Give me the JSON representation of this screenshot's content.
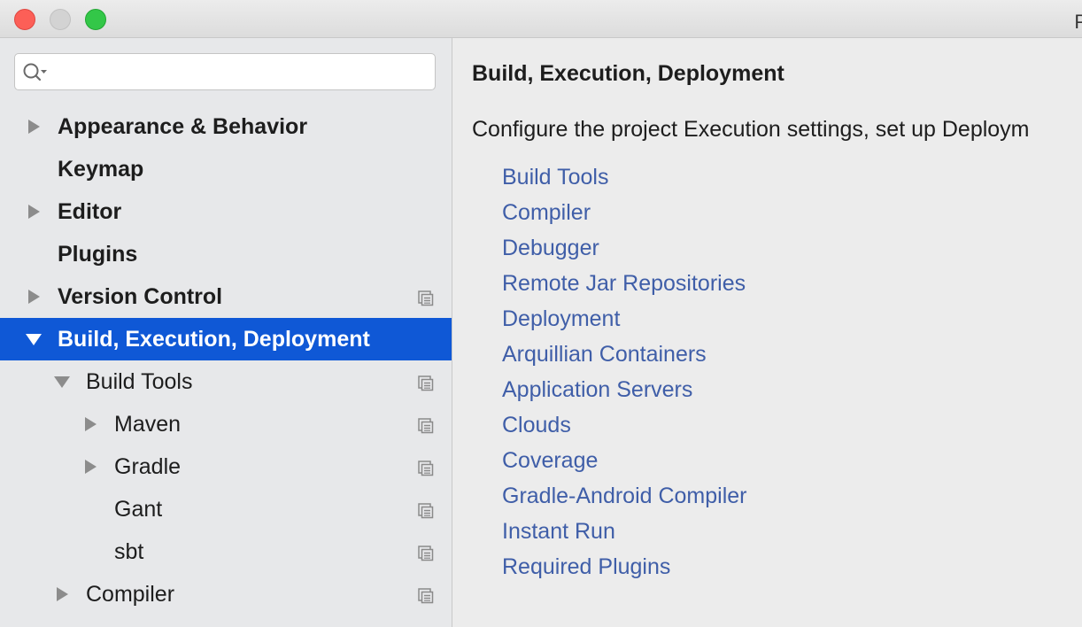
{
  "window": {
    "title": "P"
  },
  "search": {
    "placeholder": "",
    "value": ""
  },
  "tree": [
    {
      "label": "Appearance & Behavior",
      "level": 0,
      "expander": "collapsed",
      "bold": true,
      "selected": false,
      "project_icon": false
    },
    {
      "label": "Keymap",
      "level": 0,
      "expander": "none",
      "bold": true,
      "selected": false,
      "project_icon": false
    },
    {
      "label": "Editor",
      "level": 0,
      "expander": "collapsed",
      "bold": true,
      "selected": false,
      "project_icon": false
    },
    {
      "label": "Plugins",
      "level": 0,
      "expander": "none",
      "bold": true,
      "selected": false,
      "project_icon": false
    },
    {
      "label": "Version Control",
      "level": 0,
      "expander": "collapsed",
      "bold": true,
      "selected": false,
      "project_icon": true
    },
    {
      "label": "Build, Execution, Deployment",
      "level": 0,
      "expander": "expanded",
      "bold": true,
      "selected": true,
      "project_icon": false
    },
    {
      "label": "Build Tools",
      "level": 1,
      "expander": "expanded",
      "bold": false,
      "selected": false,
      "project_icon": true
    },
    {
      "label": "Maven",
      "level": 2,
      "expander": "collapsed",
      "bold": false,
      "selected": false,
      "project_icon": true
    },
    {
      "label": "Gradle",
      "level": 2,
      "expander": "collapsed",
      "bold": false,
      "selected": false,
      "project_icon": true
    },
    {
      "label": "Gant",
      "level": 2,
      "expander": "none",
      "bold": false,
      "selected": false,
      "project_icon": true
    },
    {
      "label": "sbt",
      "level": 2,
      "expander": "none",
      "bold": false,
      "selected": false,
      "project_icon": true
    },
    {
      "label": "Compiler",
      "level": 1,
      "expander": "collapsed",
      "bold": false,
      "selected": false,
      "project_icon": true
    }
  ],
  "content": {
    "title": "Build, Execution, Deployment",
    "description": "Configure the project Execution settings, set up Deploym",
    "links": [
      "Build Tools",
      "Compiler",
      "Debugger",
      "Remote Jar Repositories",
      "Deployment",
      "Arquillian Containers",
      "Application Servers",
      "Clouds",
      "Coverage",
      "Gradle-Android Compiler",
      "Instant Run",
      "Required Plugins"
    ]
  },
  "colors": {
    "selection": "#0f58d6",
    "link": "#3f5ea8",
    "sidebar_bg": "#e7e8ea",
    "content_bg": "#ececec"
  }
}
